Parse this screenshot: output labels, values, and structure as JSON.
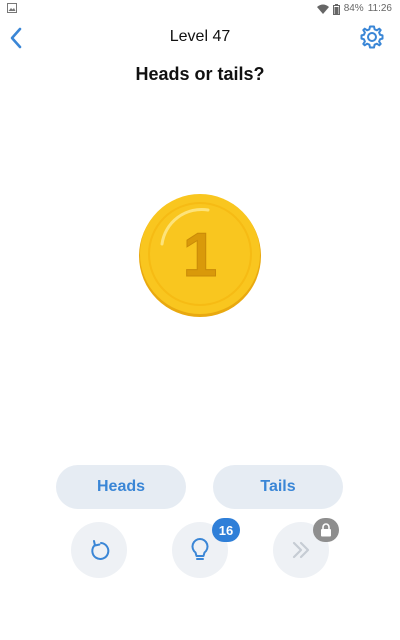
{
  "status_bar": {
    "battery": "84%",
    "time": "11:26",
    "icons": [
      "image-icon",
      "wifi-icon",
      "battery-icon"
    ]
  },
  "header": {
    "back_icon": "chevron-left-icon",
    "title": "Level 47",
    "settings_icon": "gear-icon"
  },
  "question": "Heads or tails?",
  "coin": {
    "face_value": "1"
  },
  "answers": {
    "heads_label": "Heads",
    "tails_label": "Tails"
  },
  "controls": {
    "restart_icon": "restart-icon",
    "hint_icon": "lightbulb-icon",
    "hint_count": "16",
    "skip_icon": "double-chevron-right-icon",
    "skip_locked_icon": "lock-icon"
  },
  "colors": {
    "accent": "#3a86d6",
    "badge_blue": "#2f7fd8",
    "coin_gold": "#f9c61f",
    "button_bg": "#e6ecf3"
  }
}
